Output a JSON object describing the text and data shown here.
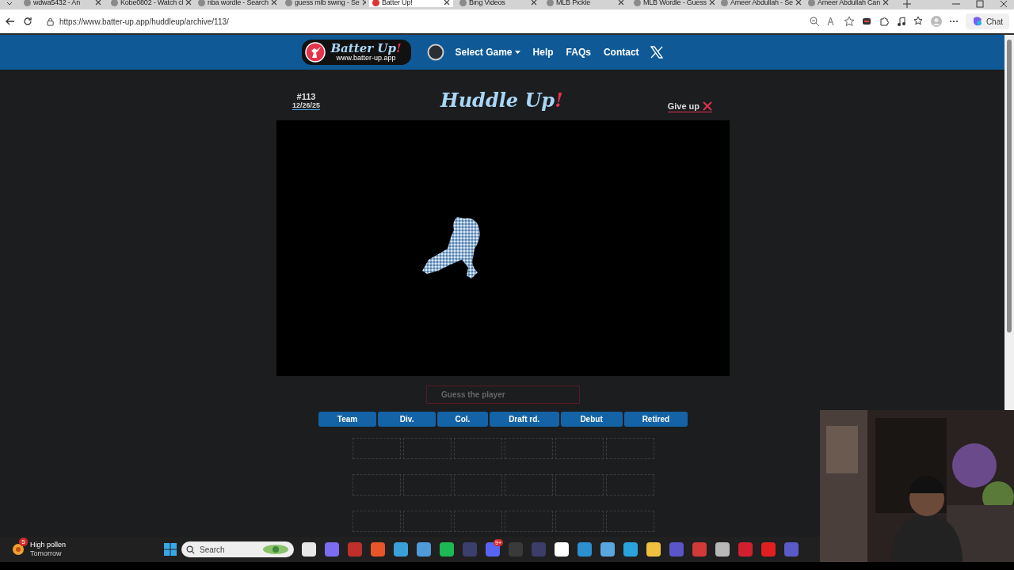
{
  "browser": {
    "tabs": [
      {
        "title": "wdwa5432 - An",
        "selected": false
      },
      {
        "title": "Kobe0802 - Watch cl",
        "selected": false
      },
      {
        "title": "nba wordle - Search",
        "selected": false
      },
      {
        "title": "guess mlb swing - Se",
        "selected": false
      },
      {
        "title": "Batter Up!",
        "selected": true
      },
      {
        "title": "Bing Videos",
        "selected": false
      },
      {
        "title": "MLB Pickle",
        "selected": false
      },
      {
        "title": "MLB Wordle - Guess",
        "selected": false
      },
      {
        "title": "Ameer Abdullah - Se",
        "selected": false
      },
      {
        "title": "Ameer Abdullah Can",
        "selected": false
      }
    ],
    "url": "https://www.batter-up.app/huddleup/archive/113/",
    "chat": "Chat"
  },
  "site": {
    "logo": {
      "name": "Batter Up",
      "accent": "!",
      "url": "www.batter-up.app"
    },
    "nav": [
      "Select Game",
      "Help",
      "FAQs",
      "Contact"
    ]
  },
  "game": {
    "number": "#113",
    "date": "12/26/25",
    "title": "Huddle Up",
    "title_accent": "!",
    "give_up": "Give up",
    "guess": {
      "placeholder": "Guess the player"
    },
    "columns": [
      "Team",
      "Div.",
      "Col.",
      "Draft rd.",
      "Debut",
      "Retired"
    ]
  },
  "taskbar": {
    "weather": {
      "badge": "5",
      "title": "High pollen",
      "subtitle": "Tomorrow"
    },
    "search": {
      "placeholder": "Search"
    },
    "app_badge": "9+"
  }
}
